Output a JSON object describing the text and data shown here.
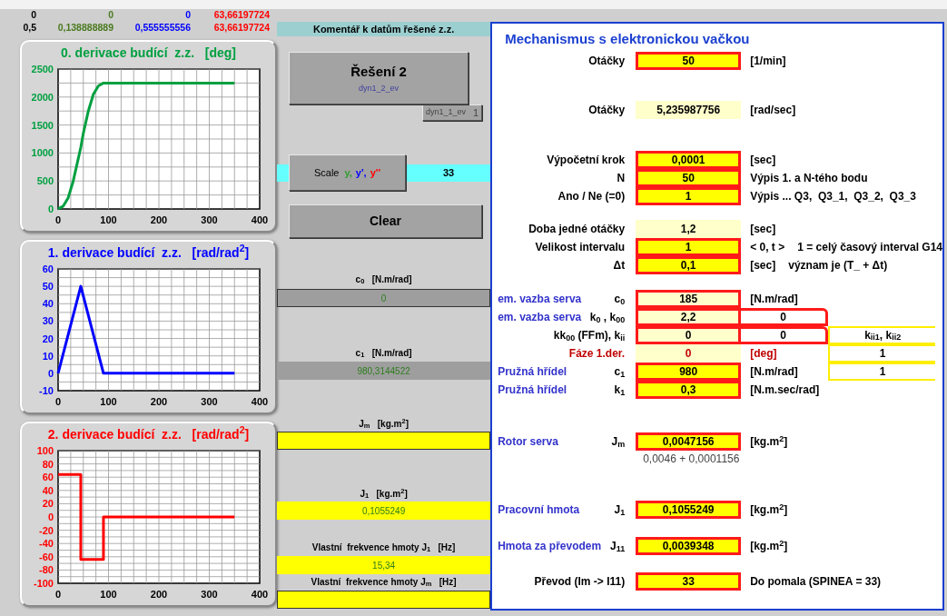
{
  "data_rows": [
    [
      "0",
      "0",
      "0",
      "63,66197724"
    ],
    [
      "0,5",
      "0,138888889",
      "0,555555556",
      "63,66197724"
    ]
  ],
  "charts": [
    {
      "chart_data": {
        "type": "line",
        "title": "0. derivace budící  z.z.   [deg]",
        "x": [
          0,
          10,
          20,
          30,
          40,
          45,
          50,
          60,
          70,
          80,
          90,
          150,
          200,
          250,
          300,
          350
        ],
        "series": [
          {
            "color": "#00a040",
            "values": [
              0,
              50,
              200,
              500,
              900,
              1100,
              1350,
              1750,
              2050,
              2200,
              2250,
              2250,
              2250,
              2250,
              2250,
              2250
            ]
          }
        ],
        "grid": true,
        "xlim": [
          0,
          400
        ],
        "ylim": [
          0,
          2500
        ],
        "xticks": [
          0,
          100,
          200,
          300,
          400
        ],
        "yticks": [
          0,
          500,
          1000,
          1500,
          2000,
          2500
        ]
      }
    },
    {
      "chart_data": {
        "type": "line",
        "title": "1. derivace budící  z.z.   [rad/rad$^{2}$]",
        "x": [
          0,
          45,
          90,
          200,
          350
        ],
        "series": [
          {
            "color": "#0000ff",
            "values": [
              0,
              50,
              0,
              0,
              0
            ]
          }
        ],
        "grid": true,
        "xlim": [
          0,
          400
        ],
        "ylim": [
          -10,
          60
        ],
        "xticks": [
          0,
          100,
          200,
          300,
          400
        ],
        "yticks": [
          -10,
          0,
          10,
          20,
          30,
          40,
          50,
          60
        ]
      }
    },
    {
      "chart_data": {
        "type": "line",
        "title": "2. derivace budící  z.z.   [rad/rad$^{2}$]",
        "x": [
          0,
          45,
          45,
          90,
          90,
          350
        ],
        "series": [
          {
            "color": "#ff0000",
            "values": [
              64,
              64,
              -64,
              -64,
              0,
              0
            ]
          }
        ],
        "grid": true,
        "xlim": [
          0,
          400
        ],
        "ylim": [
          -100,
          100
        ],
        "xticks": [
          0,
          100,
          200,
          300,
          400
        ],
        "yticks": [
          -100,
          -80,
          -60,
          -40,
          -20,
          0,
          20,
          40,
          60,
          80,
          100
        ]
      }
    }
  ],
  "comment_bar": {
    "label": "Komentář k datům řešené z.z."
  },
  "solve_button": {
    "label": "Řešení 2",
    "macro": "dyn1_2_ev"
  },
  "hidden_button": {
    "label": "1",
    "macro": "dyn1_1_ev"
  },
  "scale": {
    "label": "Scale",
    "symbols": [
      {
        "text": "y,",
        "color": "#2e9e2e"
      },
      {
        "text": "y',",
        "color": "#0000ff"
      },
      {
        "text": "y''",
        "color": "#ff0000"
      }
    ],
    "value": "33"
  },
  "clear_button": {
    "label": "Clear"
  },
  "fields": [
    {
      "label": "c$_{0}$   [N.m/rad]",
      "value": "0",
      "kind": "result",
      "outlined": true
    },
    {
      "label": "c$_{1}$   [N.m/rad]",
      "value": "980,3144522",
      "kind": "result",
      "outlined": false
    },
    {
      "label": "J$_{m}$   [kg.m$^{2}$]",
      "kind": "input",
      "outlined": true
    },
    {
      "label": "J$_{1}$   [kg.m$^{2}$]",
      "value": "0,1055249",
      "kind": "input",
      "outlined": false
    },
    {
      "label": "Vlastní  frekvence hmoty J$_{1}$   [Hz]",
      "value": "15,34",
      "kind": "input",
      "outlined": false
    },
    {
      "label": "Vlastní  frekvence hmoty J$_{m}$   [Hz]",
      "kind": "input",
      "outlined": true
    }
  ],
  "panel": {
    "title": "Mechanismus s elektronickou vačkou",
    "groups": [
      [
        {
          "kind": "plain",
          "label": "Otáčky",
          "value": "50",
          "editable": true,
          "framed": true,
          "unit": "[1/min]"
        }
      ],
      [
        {
          "kind": "plain",
          "label": "Otáčky",
          "value": "5,235987756",
          "editable": false,
          "framed": false,
          "unit": "[rad/sec]"
        }
      ],
      [
        {
          "kind": "plain",
          "label": "Výpočetní krok",
          "value": "0,0001",
          "editable": true,
          "framed": true,
          "unit": "[sec]"
        },
        {
          "kind": "plain",
          "label": "N",
          "value": "50",
          "editable": true,
          "framed": true,
          "unit": "Výpis 1. a N-tého bodu"
        },
        {
          "kind": "plain",
          "label": "Ano / Ne (=0)",
          "value": "1",
          "editable": true,
          "framed": true,
          "unit": "Výpis ... Q3,  Q3_1,  Q3_2,  Q3_3"
        }
      ],
      [
        {
          "kind": "plain",
          "label": "Doba jedné otáčky",
          "value": "1,2",
          "editable": false,
          "framed": false,
          "unit": "[sec]"
        },
        {
          "kind": "plain",
          "label": "Velikost intervalu",
          "value": "1",
          "editable": true,
          "framed": true,
          "unit": "< 0, t >",
          "note": "1 = celý časový interval G14"
        },
        {
          "kind": "plain",
          "label": "Δt",
          "value": "0,1",
          "editable": true,
          "framed": true,
          "unit": "[sec]",
          "note": "význam je (T_ + Δt)"
        }
      ],
      [
        {
          "kind": "named",
          "name": "em. vazba serva",
          "label": "c$_{0}$",
          "value": "185",
          "editable": false,
          "framed": true,
          "unit": "[N.m/rad]"
        },
        {
          "kind": "named",
          "name": "em. vazba serva",
          "label": "k$_{0}$ , k$_{00}$",
          "value": "2,2",
          "editable": false,
          "framed": true,
          "extras": [
            {
              "kind": "coupled",
              "value": "0"
            }
          ]
        },
        {
          "kind": "plain",
          "label": "kk$_{00}$ (FFm), k$_{ii}$",
          "value": "0",
          "editable": false,
          "framed": true,
          "extras": [
            {
              "kind": "coupled",
              "value": "0"
            },
            {
              "kind": "gain",
              "value": "k$_{ii1}$, k$_{ii2}$"
            }
          ]
        },
        {
          "kind": "phase",
          "label": "Fáze 1.der.",
          "value": "0",
          "editable": false,
          "framed": false,
          "unit": "[deg]",
          "extras": [
            {
              "kind": "gain",
              "value": "1"
            }
          ]
        },
        {
          "kind": "named",
          "name": "Pružná hřídel",
          "label": "c$_{1}$",
          "value": "980",
          "editable": true,
          "framed": true,
          "unit": "[N.m/rad]",
          "extras": [
            {
              "kind": "gain",
              "value": "1"
            }
          ]
        },
        {
          "kind": "named",
          "name": "Pružná hřídel",
          "label": "k$_{1}$",
          "value": "0,3",
          "editable": true,
          "framed": true,
          "unit": "[N.m.sec/rad]"
        }
      ],
      [
        {
          "kind": "named",
          "name": "Rotor serva",
          "label": "J$_{m}$",
          "value": "0,0047156",
          "editable": true,
          "framed": true,
          "unit": "[kg.m$^{2}$]",
          "formula": "0,0046 + 0,0001156"
        }
      ],
      [
        {
          "kind": "named",
          "name": "Pracovní hmota",
          "label": "J$_{1}$",
          "value": "0,1055249",
          "editable": true,
          "framed": true,
          "unit": "[kg.m$^{2}$]"
        }
      ],
      [
        {
          "kind": "named",
          "name": "Hmota za převodem",
          "label": "J$_{11}$",
          "value": "0,0039348",
          "editable": true,
          "framed": true,
          "unit": "[kg.m$^{2}$]"
        }
      ],
      [
        {
          "kind": "plain",
          "label": "Převod  (Im -> I11)",
          "value": "33",
          "editable": true,
          "framed": true,
          "unit": "Do pomala (SPINEA = 33)"
        }
      ]
    ]
  }
}
